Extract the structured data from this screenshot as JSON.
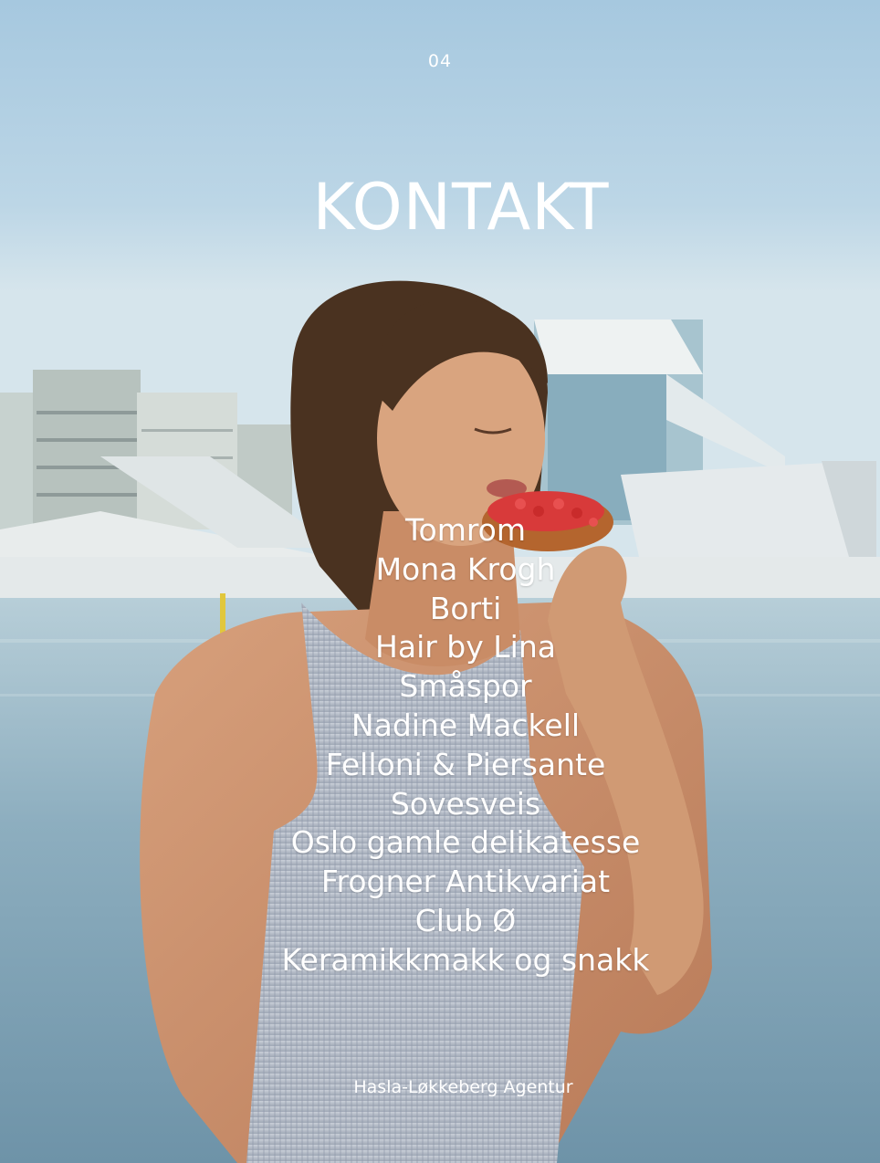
{
  "page_number": "04",
  "title": "KONTAKT",
  "contacts": [
    "Tomrom",
    "Mona Krogh",
    "Borti",
    "Hair by Lina",
    "Småspor",
    "Nadine Mackell",
    "Felloni & Piersante",
    "Sovesveis",
    "Oslo gamle delikatesse",
    "Frogner Antikvariat",
    "Club Ø",
    "Keramikkmakk og snakk"
  ],
  "footer": "Hasla-Løkkeberg Agentur",
  "colors": {
    "text": "#ffffff",
    "sky": "#a9cbe0",
    "water": "#8fb4c6"
  }
}
